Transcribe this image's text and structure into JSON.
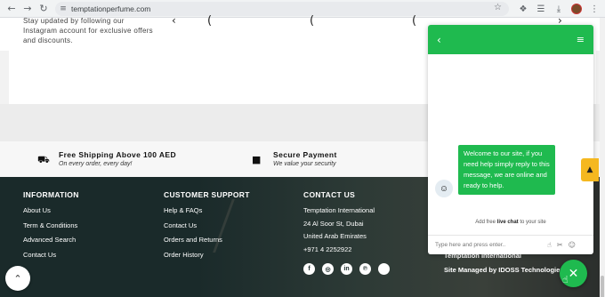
{
  "browser": {
    "url": "temptationperfume.com",
    "back_icon": "←",
    "forward_icon": "→",
    "reload_icon": "↻",
    "tune_icon": "≡",
    "star_icon": "☆",
    "extensions_icon": "❖",
    "media_icon": "☰",
    "download_icon": "⤓",
    "menu_icon": "⋮"
  },
  "instagram": {
    "text": "Stay updated by following our Instagram account for exclusive offers and discounts."
  },
  "carousel": {
    "prev": "‹",
    "next": "›"
  },
  "features": [
    {
      "icon": "truck-icon",
      "glyph": "⛟",
      "title": "Free Shipping Above 100 AED",
      "subtitle": "On every order, every day!"
    },
    {
      "icon": "lock-icon",
      "glyph": "■",
      "title": "Secure Payment",
      "subtitle": "We value your security"
    }
  ],
  "footer": {
    "information": {
      "heading": "INFORMATION",
      "links": [
        "About Us",
        "Term & Conditions",
        "Advanced Search",
        "Contact Us"
      ]
    },
    "support": {
      "heading": "CUSTOMER SUPPORT",
      "links": [
        "Help & FAQs",
        "Contact Us",
        "Orders and Returns",
        "Order History"
      ]
    },
    "contact": {
      "heading": "CONTACT US",
      "lines": [
        "Temptation International",
        "24 Al Soor St, Dubai",
        "United Arab Emirates",
        "+971 4 2252922"
      ]
    },
    "socials": [
      "f",
      "◎",
      "in",
      "℗",
      ""
    ],
    "copyright_name": "Temptation International",
    "managed": "Site Managed by IDOSS Technologies"
  },
  "chat": {
    "header_back": "‹",
    "header_menu": "≡",
    "message": "Welcome to our site, if you need help simply reply to this message, we are online and ready to help.",
    "powered_prefix": "Add free ",
    "powered_link": "live chat",
    "powered_suffix": " to your site",
    "input_placeholder": "Type here and press enter..",
    "like_icon": "☝",
    "attach_icon": "✂",
    "emoji_icon": "☺"
  },
  "scroll_top_icon": "⌃",
  "close_icon": "✕",
  "side_tab_icon": "▲",
  "colors": {
    "chat_green": "#1fba4f",
    "footer_bg": "#1a2a2a",
    "side_tab": "#f5b820"
  }
}
